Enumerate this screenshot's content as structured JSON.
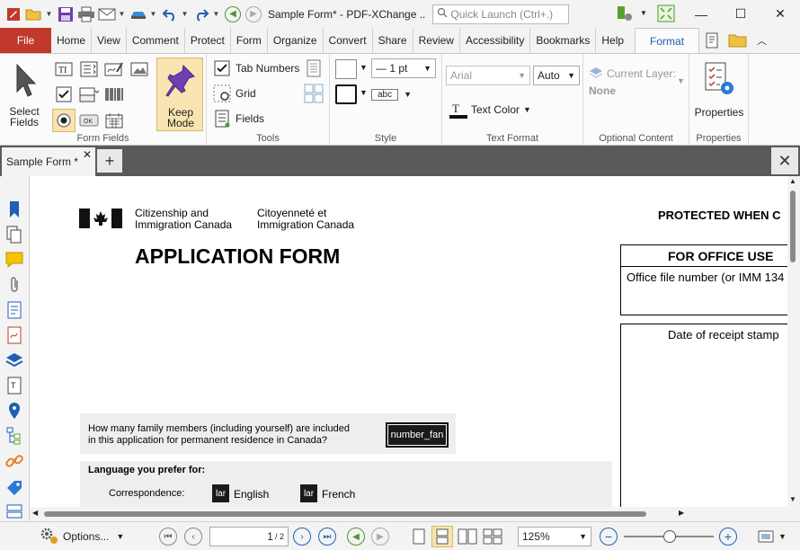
{
  "titlebar": {
    "title": "Sample Form* - PDF-XChange ..",
    "quick_launch_placeholder": "Quick Launch (Ctrl+.)"
  },
  "menu": {
    "file": "File",
    "tabs": [
      "Home",
      "View",
      "Comment",
      "Protect",
      "Form",
      "Organize",
      "Convert",
      "Share",
      "Review",
      "Accessibility",
      "Bookmarks",
      "Help"
    ],
    "active_tab": "Format"
  },
  "ribbon": {
    "form_fields": {
      "select_fields": "Select\nFields",
      "keep_mode": "Keep\nMode",
      "label": "Form Fields"
    },
    "tools": {
      "tab_numbers": "Tab Numbers",
      "grid": "Grid",
      "fields": "Fields",
      "label": "Tools"
    },
    "style": {
      "line_width": "— 1 pt",
      "line_style": "abc",
      "label": "Style"
    },
    "text_format": {
      "font": "Arial",
      "size": "Auto",
      "text_color": "Text Color",
      "label": "Text Format"
    },
    "optional_content": {
      "current_layer": "Current Layer:",
      "layer_value": "None",
      "label": "Optional Content"
    },
    "properties": {
      "button": "Properties",
      "label": "Properties"
    }
  },
  "document": {
    "tab_title": "Sample Form *"
  },
  "page": {
    "dept_en_line1": "Citizenship and",
    "dept_en_line2": "Immigration Canada",
    "dept_fr_line1": "Citoyenneté et",
    "dept_fr_line2": "Immigration Canada",
    "protected": "PROTECTED WHEN C",
    "title": "APPLICATION FORM",
    "office_use": "FOR OFFICE USE",
    "office_file": "Office file number (or IMM 134",
    "receipt": "Date of receipt stamp",
    "family_q1": "How many family members (including yourself) are included",
    "family_q2": "in this application for permanent residence in Canada?",
    "family_field": "number_fan",
    "language_heading": "Language you prefer for:",
    "correspondence": "Correspondence:",
    "lang_field_1": "lar",
    "english": "English",
    "lang_field_2": "lar",
    "french": "French"
  },
  "statusbar": {
    "options": "Options...",
    "page_current": "1",
    "page_total": "/ 2",
    "zoom": "125%"
  },
  "colors": {
    "file_tab": "#c0392b",
    "active_tab_text": "#1f5fb5",
    "doc_bar": "#5a5a5a"
  }
}
